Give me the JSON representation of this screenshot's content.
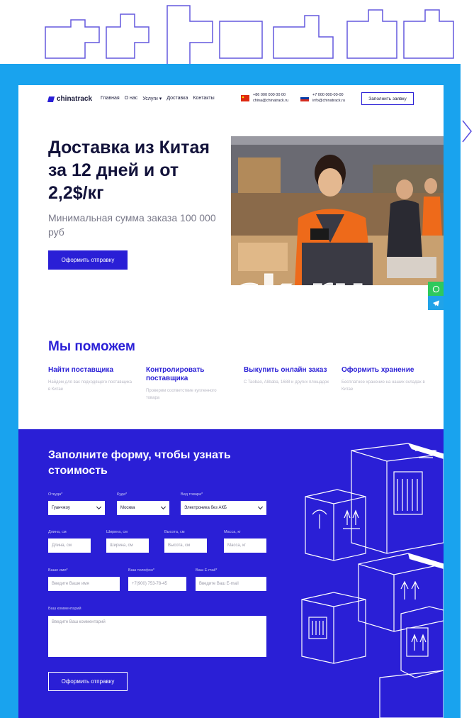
{
  "header": {
    "logo": "chinatrack",
    "nav": [
      "Главная",
      "О нас",
      "Услуги",
      "Доставка",
      "Контакты"
    ],
    "contact_china": [
      "+86 000 000 00 00",
      "china@chinatrack.ru"
    ],
    "contact_russia": [
      "+7 000 000-00-00",
      "info@chinatrack.ru"
    ],
    "cta": "Заполнить заявку"
  },
  "hero": {
    "title": "Доставка из Китая за 12 дней и от 2,2$/кг",
    "subtitle": "Минимальная сумма заказа 100 000 руб",
    "button": "Оформить отправку",
    "watermark": "chinatrack.ru"
  },
  "help": {
    "title": "Мы поможем",
    "items": [
      {
        "name": "Найти поставщика",
        "desc": "Найдем для вас подходящего поставщика в Китае"
      },
      {
        "name": "Контролировать поставщика",
        "desc": "Проверим соответствие купленного товара"
      },
      {
        "name": "Выкупить онлайн заказ",
        "desc": "С Taobao, Alibaba, 1688 и других площадок"
      },
      {
        "name": "Оформить хранение",
        "desc": "Бесплатное хранение на наших складах в Китае"
      }
    ]
  },
  "form": {
    "title": "Заполните форму, чтобы узнать стоимость",
    "from_label": "Откуда*",
    "from_value": "Гуанчжоу",
    "to_label": "Куда*",
    "to_value": "Москва",
    "cargo_label": "Вид товара*",
    "cargo_value": "Электроника без АКБ",
    "length_label": "Длина, см",
    "length_ph": "Длина, см",
    "width_label": "Ширина, см",
    "width_ph": "Ширина, см",
    "height_label": "Высота, см",
    "height_ph": "Высота, см",
    "weight_label": "Масса, кг",
    "weight_ph": "Масса, кг",
    "name_label": "Ваше имя*",
    "name_ph": "Введите Ваше имя",
    "phone_label": "Ваш телефон*",
    "phone_ph": "+7(900) 753-78-45",
    "email_label": "Ваш E-mail*",
    "email_ph": "Введите Ваш E-mail",
    "comment_label": "Ваш комментарий",
    "comment_ph": "Введите Ваш комментарий",
    "button": "Оформить отправку"
  },
  "colors": {
    "brand": "#2a1fd6",
    "frame": "#19a3ee",
    "whatsapp": "#2ec95c",
    "telegram": "#21a3e8"
  },
  "icons": [
    "whatsapp-icon",
    "telegram-icon",
    "china-flag-icon",
    "russia-flag-icon",
    "chevron-down-icon",
    "chevron-right-icon"
  ]
}
